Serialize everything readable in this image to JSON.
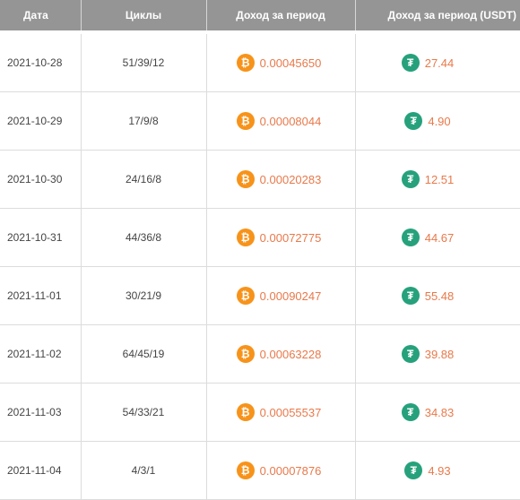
{
  "columns": {
    "date": "Дата",
    "cycles": "Циклы",
    "btc_income": "Доход за период",
    "usdt_income": "Доход за период (USDT)"
  },
  "icons": {
    "btc": {
      "name": "bitcoin-icon",
      "glyph": "₿",
      "color": "#f7931a"
    },
    "usdt": {
      "name": "tether-icon",
      "glyph": "₮",
      "color": "#26a17b"
    }
  },
  "accent_color": "#e8794a",
  "rows": [
    {
      "date": "2021-10-28",
      "cycles": "51/39/12",
      "btc": "0.00045650",
      "usdt": "27.44"
    },
    {
      "date": "2021-10-29",
      "cycles": "17/9/8",
      "btc": "0.00008044",
      "usdt": "4.90"
    },
    {
      "date": "2021-10-30",
      "cycles": "24/16/8",
      "btc": "0.00020283",
      "usdt": "12.51"
    },
    {
      "date": "2021-10-31",
      "cycles": "44/36/8",
      "btc": "0.00072775",
      "usdt": "44.67"
    },
    {
      "date": "2021-11-01",
      "cycles": "30/21/9",
      "btc": "0.00090247",
      "usdt": "55.48"
    },
    {
      "date": "2021-11-02",
      "cycles": "64/45/19",
      "btc": "0.00063228",
      "usdt": "39.88"
    },
    {
      "date": "2021-11-03",
      "cycles": "54/33/21",
      "btc": "0.00055537",
      "usdt": "34.83"
    },
    {
      "date": "2021-11-04",
      "cycles": "4/3/1",
      "btc": "0.00007876",
      "usdt": "4.93"
    }
  ]
}
